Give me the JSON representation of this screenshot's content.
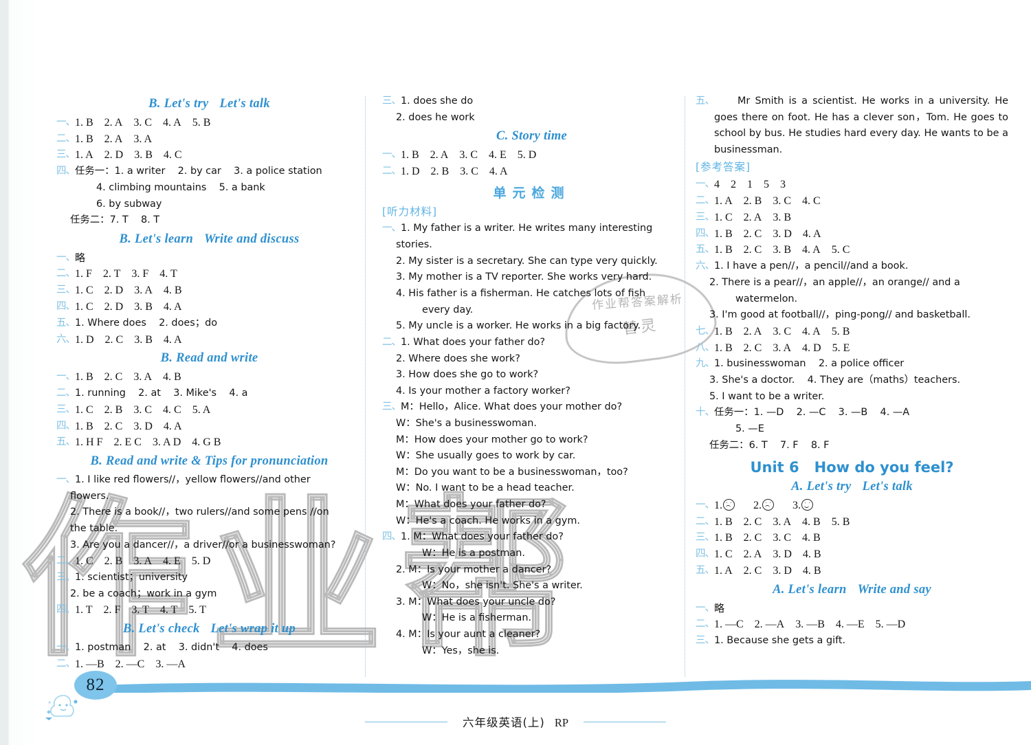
{
  "page": {
    "number": "82",
    "footer_text": "六年级英语(上)",
    "footer_code": "RP",
    "watermark_main": "作业帮",
    "watermark_stamp_line1": "作业帮答案解析",
    "watermark_stamp_line2": "替灵"
  },
  "colors": {
    "heading_blue": "#2e90cf",
    "marker_blue": "#7fc2e4",
    "page_bubble": "#7fc4ea",
    "divider": "#9fc4dc"
  },
  "column1": {
    "blocks": [
      {
        "type": "heading",
        "text_a": "B. Let's try",
        "text_b": "Let's talk"
      },
      {
        "type": "row",
        "marker": "一、",
        "style": "ser",
        "text": "1. B   2. A   3. C   4. A   5. B"
      },
      {
        "type": "row",
        "marker": "二、",
        "style": "ser",
        "text": "1. B   2. A   3. A"
      },
      {
        "type": "row",
        "marker": "三、",
        "style": "ser",
        "text": "1. A   2. D   3. B   4. C"
      },
      {
        "type": "row",
        "marker": "四、",
        "style": "hw",
        "text": "任务一：1. a writer   2. by car   3. a police station"
      },
      {
        "type": "cont",
        "indent": "indent3",
        "style": "hw",
        "text": "4. climbing mountains   5. a bank"
      },
      {
        "type": "cont",
        "indent": "indent3",
        "style": "hw",
        "text": "6. by subway"
      },
      {
        "type": "cont",
        "indent": "indent2",
        "style": "hw",
        "text": "任务二：7. T   8. T"
      },
      {
        "type": "heading",
        "text_a": "B. Let's learn",
        "text_b": "Write and discuss"
      },
      {
        "type": "row",
        "marker": "一、",
        "style": "cn",
        "text": "略"
      },
      {
        "type": "row",
        "marker": "二、",
        "style": "ser",
        "text": "1. F   2. T   3. F   4. T"
      },
      {
        "type": "row",
        "marker": "三、",
        "style": "ser",
        "text": "1. C   2. D   3. A   4. B"
      },
      {
        "type": "row",
        "marker": "四、",
        "style": "ser",
        "text": "1. C   2. D   3. B   4. A"
      },
      {
        "type": "row",
        "marker": "五、",
        "style": "hw",
        "text": "1. Where does   2. does；do"
      },
      {
        "type": "row",
        "marker": "六、",
        "style": "ser",
        "text": "1. D   2. C   3. B   4. A"
      },
      {
        "type": "heading",
        "text_a": "B. Read and write",
        "text_b": ""
      },
      {
        "type": "row",
        "marker": "一、",
        "style": "ser",
        "text": "1. B   2. C   3. A   4. B"
      },
      {
        "type": "row",
        "marker": "二、",
        "style": "hw",
        "text": "1. running   2. at   3. Mike's   4. a"
      },
      {
        "type": "row",
        "marker": "三、",
        "style": "ser",
        "text": "1. C   2. B   3. C   4. C   5. A"
      },
      {
        "type": "row",
        "marker": "四、",
        "style": "ser",
        "text": "1. B   2. C   3. D   4. A"
      },
      {
        "type": "row",
        "marker": "五、",
        "style": "ser",
        "text": "1. H F   2. E C   3. A D   4. G B"
      },
      {
        "type": "heading",
        "text_a": "B. Read and write & Tips for pronunciation",
        "text_b": ""
      },
      {
        "type": "row",
        "marker": "一、",
        "style": "hw",
        "text": "1. I like red flowers//，yellow flowers//and other"
      },
      {
        "type": "cont",
        "indent": "indent2",
        "style": "hw",
        "text": "flowers."
      },
      {
        "type": "cont",
        "indent": "indent2",
        "style": "hw",
        "text": "2. There is a book//，two rulers//and some pens //on"
      },
      {
        "type": "cont",
        "indent": "indent2",
        "style": "hw",
        "text": "the table."
      },
      {
        "type": "cont",
        "indent": "indent2",
        "style": "hw",
        "text": "3. Are you a dancer//，a driver//or a businesswoman?"
      },
      {
        "type": "row",
        "marker": "二、",
        "style": "ser",
        "text": "1. C   2. B   3. A   4. E   5. D"
      },
      {
        "type": "row",
        "marker": "三、",
        "style": "hw",
        "text": "1. scientist；university"
      },
      {
        "type": "cont",
        "indent": "indent2",
        "style": "hw",
        "text": "2. be a coach；work in a gym"
      },
      {
        "type": "row",
        "marker": "四、",
        "style": "ser",
        "text": "1. T   2. F   3. T   4. T   5. T"
      },
      {
        "type": "heading",
        "text_a": "B. Let's check",
        "text_b": "Let's wrap it up"
      },
      {
        "type": "row",
        "marker": "一、",
        "style": "hw",
        "text": "1. postman   2. at   3. didn't   4. does"
      },
      {
        "type": "row",
        "marker": "二、",
        "style": "ser",
        "text": "1. —B   2. —C   3. —A"
      }
    ]
  },
  "column2": {
    "blocks": [
      {
        "type": "row",
        "marker": "三、",
        "style": "hw",
        "text": "1. does she do"
      },
      {
        "type": "cont",
        "indent": "indent2",
        "style": "hw",
        "text": "2. does he work"
      },
      {
        "type": "heading",
        "text_a": "C. Story time",
        "text_b": ""
      },
      {
        "type": "row",
        "marker": "一、",
        "style": "ser",
        "text": "1. B   2. A   3. C   4. E   5. D"
      },
      {
        "type": "row",
        "marker": "二、",
        "style": "ser",
        "text": "1. D   2. B   3. C   4. A"
      },
      {
        "type": "heading-cn",
        "text_a": "单元检测",
        "text_b": ""
      },
      {
        "type": "bracket",
        "text_a": "[听力材料]",
        "text_b": ""
      },
      {
        "type": "row",
        "marker": "一、",
        "style": "hw",
        "text": "1. My father is a writer. He writes many interesting"
      },
      {
        "type": "cont",
        "indent": "indent2",
        "style": "hw",
        "text": "stories."
      },
      {
        "type": "cont",
        "indent": "indent2",
        "style": "hw",
        "text": "2. My sister is a secretary. She can type very quickly."
      },
      {
        "type": "cont",
        "indent": "indent2",
        "style": "hw",
        "text": "3. My mother is a TV reporter. She works very hard."
      },
      {
        "type": "cont",
        "indent": "indent2",
        "style": "hw",
        "text": "4. His father is a fisherman. He catches lots of fish"
      },
      {
        "type": "cont",
        "indent": "indent3",
        "style": "hw",
        "text": "every day."
      },
      {
        "type": "cont",
        "indent": "indent2",
        "style": "hw",
        "text": "5. My uncle is a worker. He works in a big factory."
      },
      {
        "type": "row",
        "marker": "二、",
        "style": "hw",
        "text": "1. What does your father do?"
      },
      {
        "type": "cont",
        "indent": "indent2",
        "style": "hw",
        "text": "2. Where does she work?"
      },
      {
        "type": "cont",
        "indent": "indent2",
        "style": "hw",
        "text": "3. How does she go to work?"
      },
      {
        "type": "cont",
        "indent": "indent2",
        "style": "hw",
        "text": "4. Is your mother a factory worker?"
      },
      {
        "type": "row",
        "marker": "三、",
        "style": "hw",
        "text": "M：Hello，Alice. What does your mother do?"
      },
      {
        "type": "cont",
        "indent": "indent2",
        "style": "hw",
        "text": "W：She's a businesswoman."
      },
      {
        "type": "cont",
        "indent": "indent2",
        "style": "hw",
        "text": "M：How does your mother go to work?"
      },
      {
        "type": "cont",
        "indent": "indent2",
        "style": "hw",
        "text": "W：She usually goes to work by car."
      },
      {
        "type": "cont",
        "indent": "indent2",
        "style": "hw",
        "text": "M：Do you want to be a businesswoman，too?"
      },
      {
        "type": "cont",
        "indent": "indent2",
        "style": "hw",
        "text": "W：No. I want to be a head teacher."
      },
      {
        "type": "cont",
        "indent": "indent2",
        "style": "hw",
        "text": "M：What does your father do?"
      },
      {
        "type": "cont",
        "indent": "indent2",
        "style": "hw",
        "text": "W：He's a coach. He works in a gym."
      },
      {
        "type": "row",
        "marker": "四、",
        "style": "hw",
        "text": "1. M：What does your father do?"
      },
      {
        "type": "cont",
        "indent": "indent3",
        "style": "hw",
        "text": "W：He is a postman."
      },
      {
        "type": "cont",
        "indent": "indent2",
        "style": "hw",
        "text": "2. M：Is your mother a dancer?"
      },
      {
        "type": "cont",
        "indent": "indent3",
        "style": "hw",
        "text": "W：No，she isn't. She's a writer."
      },
      {
        "type": "cont",
        "indent": "indent2",
        "style": "hw",
        "text": "3. M：What does your uncle do?"
      },
      {
        "type": "cont",
        "indent": "indent3",
        "style": "hw",
        "text": "W：He is a fisherman."
      },
      {
        "type": "cont",
        "indent": "indent2",
        "style": "hw",
        "text": "4. M：Is your aunt a cleaner?"
      },
      {
        "type": "cont",
        "indent": "indent3",
        "style": "hw",
        "text": "W：Yes，she is."
      }
    ]
  },
  "column3": {
    "blocks": [
      {
        "type": "row-para",
        "marker": "五、",
        "style": "hw",
        "text": "Mr Smith is a scientist. He works in a university. He goes there on foot. He has a clever son，Tom. He goes to school by bus. He studies hard every day. He wants to be a businessman."
      },
      {
        "type": "bracket",
        "text_a": "[参考答案]",
        "text_b": ""
      },
      {
        "type": "row",
        "marker": "一、",
        "style": "ser",
        "text": "4   2   1   5   3"
      },
      {
        "type": "row",
        "marker": "二、",
        "style": "ser",
        "text": "1. A   2. B   3. C   4. C"
      },
      {
        "type": "row",
        "marker": "三、",
        "style": "ser",
        "text": "1. C   2. A   3. B"
      },
      {
        "type": "row",
        "marker": "四、",
        "style": "ser",
        "text": "1. B   2. C   3. D   4. A"
      },
      {
        "type": "row",
        "marker": "五、",
        "style": "ser",
        "text": "1. B   2. C   3. B   4. A   5. C"
      },
      {
        "type": "row",
        "marker": "六、",
        "style": "hw",
        "text": "1. I have a pen//，a pencil//and a book."
      },
      {
        "type": "cont",
        "indent": "indent2",
        "style": "hw",
        "text": "2. There is a pear//，an apple//，an orange// and a"
      },
      {
        "type": "cont",
        "indent": "indent3",
        "style": "hw",
        "text": "watermelon."
      },
      {
        "type": "cont",
        "indent": "indent2",
        "style": "hw",
        "text": "3. I'm good at football//，ping-pong// and basketball."
      },
      {
        "type": "row",
        "marker": "七、",
        "style": "ser",
        "text": "1. B   2. A   3. C   4. A   5. B"
      },
      {
        "type": "row",
        "marker": "八、",
        "style": "ser",
        "text": "1. B   2. C   3. A   4. D   5. E"
      },
      {
        "type": "row",
        "marker": "九、",
        "style": "hw",
        "text": "1. businesswoman   2. a police officer"
      },
      {
        "type": "cont",
        "indent": "indent2",
        "style": "hw",
        "text": "3. She's a doctor.   4. They are（maths）teachers."
      },
      {
        "type": "cont",
        "indent": "indent2",
        "style": "hw",
        "text": "5. I want to be a writer."
      },
      {
        "type": "row",
        "marker": "十、",
        "style": "hw",
        "text": "任务一：1. —D   2. —C   3. —B   4. —A"
      },
      {
        "type": "cont",
        "indent": "indent3",
        "style": "hw",
        "text": "5. —E"
      },
      {
        "type": "cont",
        "indent": "indent2",
        "style": "hw",
        "text": "任务二：6. T   7. F   8. F"
      },
      {
        "type": "heading-unit",
        "text_a": "Unit 6",
        "text_b": "How do you feel?"
      },
      {
        "type": "heading",
        "text_a": "A. Let's try",
        "text_b": "Let's talk"
      },
      {
        "type": "row-faces",
        "marker": "一、",
        "faces": [
          "sad",
          "sad",
          "happy"
        ]
      },
      {
        "type": "row",
        "marker": "二、",
        "style": "ser",
        "text": "1. B   2. C   3. A   4. B   5. B"
      },
      {
        "type": "row",
        "marker": "三、",
        "style": "ser",
        "text": "1. B   2. C   3. C   4. B"
      },
      {
        "type": "row",
        "marker": "四、",
        "style": "ser",
        "text": "1. C   2. A   3. D   4. B"
      },
      {
        "type": "row",
        "marker": "五、",
        "style": "ser",
        "text": "1. A   2. C   3. D   4. B"
      },
      {
        "type": "heading",
        "text_a": "A. Let's learn",
        "text_b": "Write and say"
      },
      {
        "type": "row",
        "marker": "一、",
        "style": "cn",
        "text": "略"
      },
      {
        "type": "row",
        "marker": "二、",
        "style": "ser",
        "text": "1. —C   2. —A   3. —B   4. —E   5. —D"
      },
      {
        "type": "row",
        "marker": "三、",
        "style": "hw",
        "text": "1. Because she gets a gift."
      }
    ]
  }
}
